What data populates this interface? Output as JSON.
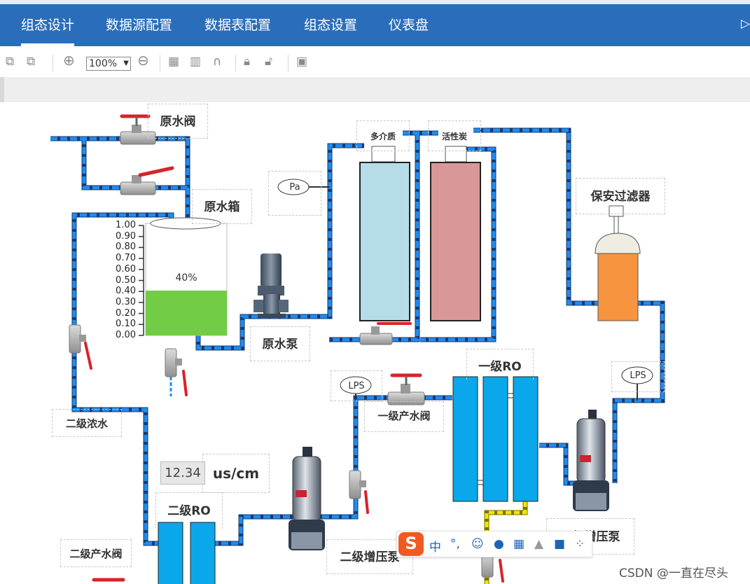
{
  "nav": {
    "tabs": [
      {
        "label": "组态设计",
        "active": true
      },
      {
        "label": "数据源配置",
        "active": false
      },
      {
        "label": "数据表配置",
        "active": false
      },
      {
        "label": "组态设置",
        "active": false
      },
      {
        "label": "仪表盘",
        "active": false
      }
    ],
    "bg_color": "#2a6ebb"
  },
  "toolbar": {
    "zoom": "100%",
    "icons": [
      "copy-icon",
      "paste-icon",
      "zoom-in-icon",
      "zoom-select",
      "zoom-out-icon",
      "grid-icon",
      "grid-toggle-icon",
      "magnet-icon",
      "lock-icon",
      "unlock-icon",
      "background-image-icon"
    ]
  },
  "diagram": {
    "labels": {
      "raw_valve": "原水阀",
      "raw_tank": "原水箱",
      "raw_pump": "原水泵",
      "multi_media": "多介质",
      "activated_carbon": "活性炭",
      "safety_filter": "保安过滤器",
      "pa": "Pa",
      "lps1": "LPS",
      "lps2": "LPS",
      "ro1": "一级RO",
      "ro1_product_valve": "一级产水阀",
      "stage2_concentrate": "二级浓水",
      "ro2": "二级RO",
      "stage2_product_valve": "二级产水阀",
      "stage2_booster_pump": "二级增压泵",
      "stage1_booster_pump": "一级增压泵",
      "conductivity_value": "12.34",
      "conductivity_unit": "us/cm"
    },
    "tank_level": {
      "fill_percent_label": "40%",
      "level": 0.4,
      "ticks": [
        "1.00",
        "0.90",
        "0.80",
        "0.70",
        "0.60",
        "0.50",
        "0.40",
        "0.30",
        "0.20",
        "0.10",
        "0.00"
      ],
      "fill_color": "#72cc45"
    },
    "colors": {
      "pipe": "#1f8cf0",
      "pipe_yellow": "#f2e600",
      "multi_media_vessel": "#b6dce8",
      "carbon_vessel": "#d99797",
      "filter_body": "#f7943f",
      "ro_membrane": "#0aa8ea",
      "valve_handle": "#d8232a"
    }
  },
  "ime": {
    "items": [
      "中",
      "°,",
      "☺",
      "mic",
      "keyboard",
      "person",
      "shirt",
      "apps"
    ]
  },
  "watermark": "CSDN @一直在尽头"
}
